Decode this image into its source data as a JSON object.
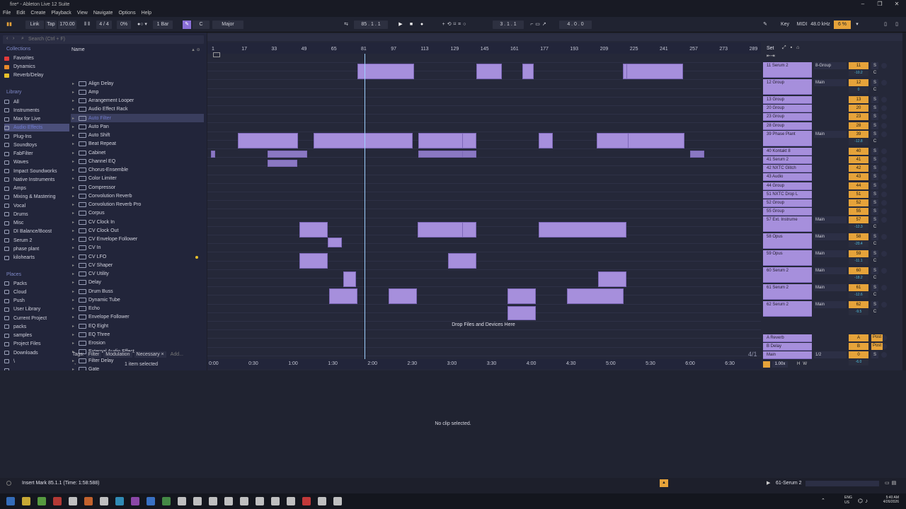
{
  "window": {
    "title": "fire* - Ableton Live 12 Suite",
    "controls": [
      "–",
      "❐",
      "✕"
    ]
  },
  "menu": [
    "File",
    "Edit",
    "Create",
    "Playback",
    "View",
    "Navigate",
    "Options",
    "Help"
  ],
  "transport": {
    "link": "Link",
    "tap": "Tap",
    "tempo": "170.00",
    "signature": "4 / 4",
    "swing": "0%",
    "quantize": "1 Bar",
    "key": "C",
    "scale": "Major",
    "position": "85 .  1 .  1",
    "loop_start": "3 .  1 .  1",
    "loop_length": "4 .  0 .  0",
    "key_map": "Key",
    "midi_map": "MIDI",
    "sample_rate": "48.0 kHz",
    "cpu": "6 %"
  },
  "browser": {
    "search_placeholder": "Search (Ctrl + F)",
    "collections_title": "Collections",
    "collections": [
      {
        "label": "Favorites",
        "color": "#e23a3a"
      },
      {
        "label": "Dynamics",
        "color": "#e88a2a"
      },
      {
        "label": "Reverb/Delay",
        "color": "#e8c02a"
      }
    ],
    "library_title": "Library",
    "library": [
      "All",
      "Instruments",
      "Max for Live",
      "Audio Effects",
      "Plug-Ins",
      "Soundtoys",
      "FabFilter",
      "Waves",
      "Impact Soundworks",
      "Native Instruments",
      "Amps",
      "Mixing & Mastering",
      "Vocal",
      "Drums",
      "Misc",
      "DI Balance/Boost",
      "Serum 2",
      "phase plant",
      "kilohearts"
    ],
    "selected_library": "Audio Effects",
    "places_title": "Places",
    "places": [
      "Packs",
      "Cloud",
      "Push",
      "User Library",
      "Current Project",
      "packs",
      "samples",
      "Project Files",
      "Downloads",
      "\\",
      ""
    ],
    "name_header": "Name",
    "items": [
      "Align Delay",
      "Amp",
      "Arrangement Looper",
      "Audio Effect Rack",
      "Auto Filter",
      "Auto Pan",
      "Auto Shift",
      "Beat Repeat",
      "Cabinet",
      "Channel EQ",
      "Chorus-Ensemble",
      "Color Limiter",
      "Compressor",
      "Convolution Reverb",
      "Convolution Reverb Pro",
      "Corpus",
      "CV Clock In",
      "CV Clock Out",
      "CV Envelope Follower",
      "CV In",
      "CV LFO",
      "CV Shaper",
      "CV Utility",
      "Delay",
      "Drum Buss",
      "Dynamic Tube",
      "Echo",
      "Envelope Follower",
      "EQ Eight",
      "EQ Three",
      "Erosion",
      "External Audio Effect",
      "Filter Delay",
      "Gate"
    ],
    "selected_item": "Auto Filter",
    "tags_label": "Tags:",
    "tags": [
      "Filter",
      "Modulation",
      "Necessary ×",
      "Add..."
    ],
    "selection_status": "1 item selected"
  },
  "arrangement": {
    "bars": [
      "1",
      "17",
      "33",
      "49",
      "65",
      "81",
      "97",
      "113",
      "129",
      "145",
      "161",
      "177",
      "193",
      "209",
      "225",
      "241",
      "257",
      "273",
      "289"
    ],
    "times": [
      "0:00",
      "0:30",
      "1:00",
      "1:30",
      "2:00",
      "2:30",
      "3:00",
      "3:30",
      "4:00",
      "4:30",
      "5:00",
      "5:30",
      "6:00",
      "6:30"
    ],
    "set_label": "Set",
    "drop_hint": "Drop Files and Devices Here",
    "zoom_label": "4/1",
    "tracks": [
      {
        "name": "11 Serum 2",
        "output": "8-Group",
        "num": "11",
        "vol": "-10.2",
        "pan": "C",
        "tall": true
      },
      {
        "name": "12 Group",
        "output": "Main",
        "num": "12",
        "vol": "0",
        "pan": "C",
        "tall": true
      },
      {
        "name": "13 Group",
        "output": "",
        "num": "13",
        "vol": "",
        "pan": "",
        "tall": false
      },
      {
        "name": "20 Group",
        "output": "",
        "num": "20",
        "vol": "",
        "pan": "",
        "tall": false
      },
      {
        "name": "23 Group",
        "output": "",
        "num": "23",
        "vol": "",
        "pan": "",
        "tall": false
      },
      {
        "name": "28 Group",
        "output": "",
        "num": "28",
        "vol": "",
        "pan": "",
        "tall": false
      },
      {
        "name": "39 Phase Plant",
        "output": "Main",
        "num": "39",
        "vol": "-12.8",
        "pan": "C",
        "tall": true
      },
      {
        "name": "40 Kontakt 8",
        "output": "",
        "num": "40",
        "vol": "",
        "pan": "",
        "tall": false
      },
      {
        "name": "41 Serum 2",
        "output": "",
        "num": "41",
        "vol": "",
        "pan": "",
        "tall": false
      },
      {
        "name": "42 NXTC Glitch",
        "output": "",
        "num": "42",
        "vol": "",
        "pan": "",
        "tall": false
      },
      {
        "name": "43 Audio",
        "output": "",
        "num": "43",
        "vol": "",
        "pan": "",
        "tall": false
      },
      {
        "name": "44 Group",
        "output": "",
        "num": "44",
        "vol": "",
        "pan": "",
        "tall": false
      },
      {
        "name": "51 NXTC Drop L",
        "output": "",
        "num": "51",
        "vol": "",
        "pan": "",
        "tall": false
      },
      {
        "name": "52 Group",
        "output": "",
        "num": "52",
        "vol": "",
        "pan": "",
        "tall": false
      },
      {
        "name": "55 Group",
        "output": "",
        "num": "55",
        "vol": "",
        "pan": "",
        "tall": false
      },
      {
        "name": "57 Ext. Instrume",
        "output": "Main",
        "num": "57",
        "vol": "-12.3",
        "pan": "C",
        "tall": true
      },
      {
        "name": "58 Opus",
        "output": "Main",
        "num": "58",
        "vol": "-20.4",
        "pan": "C",
        "tall": true
      },
      {
        "name": "59 Opus",
        "output": "Main",
        "num": "59",
        "vol": "-11.1",
        "pan": "C",
        "tall": true
      },
      {
        "name": "60 Serum 2",
        "output": "Main",
        "num": "60",
        "vol": "-18.2",
        "pan": "C",
        "tall": true
      },
      {
        "name": "61 Serum 2",
        "output": "Main",
        "num": "61",
        "vol": "-12.6",
        "pan": "C",
        "tall": true
      },
      {
        "name": "62 Serum 2",
        "output": "Main",
        "num": "62",
        "vol": "-9.5",
        "pan": "C",
        "tall": true
      },
      {
        "name": "A Reverb",
        "output": "",
        "num": "A",
        "vol": "",
        "pan": "Post",
        "tall": false
      },
      {
        "name": "B Delay",
        "output": "",
        "num": "B",
        "vol": "",
        "pan": "Post",
        "tall": false
      },
      {
        "name": "Main",
        "output": "1/2",
        "num": "0",
        "vol": "-6.0",
        "pan": "",
        "tall": false
      }
    ],
    "zoom_field": "1.00x"
  },
  "detail": {
    "empty_message": "No clip selected."
  },
  "status": {
    "message": "Insert Mark 85.1.1 (Time: 1:58:588)",
    "track_label": "61-Serum 2"
  },
  "taskbar": {
    "lang": "ENG\nUS",
    "time": "5:40 AM",
    "date": "4/26/2026"
  }
}
